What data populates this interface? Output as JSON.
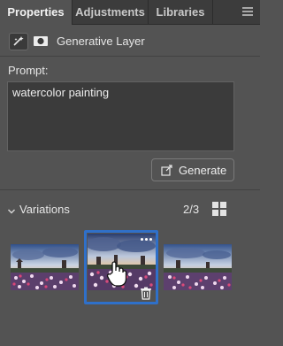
{
  "tabs": [
    {
      "label": "Properties",
      "active": true
    },
    {
      "label": "Adjustments",
      "active": false
    },
    {
      "label": "Libraries",
      "active": false
    }
  ],
  "panel_menu_icon": "hamburger-menu-icon",
  "layer": {
    "type_icon": "generative-layer-icon",
    "mask_icon": "layer-mask-icon",
    "name": "Generative Layer"
  },
  "prompt": {
    "label": "Prompt:",
    "value": "watercolor painting"
  },
  "generate_button": {
    "label": "Generate",
    "icon": "generate-icon"
  },
  "variations": {
    "label": "Variations",
    "count": "2/3",
    "selected_index": 2,
    "view_icon": "grid-view-icon",
    "items": [
      {
        "id": 1
      },
      {
        "id": 2,
        "selected": true
      },
      {
        "id": 3
      }
    ]
  },
  "colors": {
    "panel_bg": "#535353",
    "tab_bar_bg": "#3c3c3c",
    "input_bg": "#3b3b3b",
    "selection_accent": "#2f70c9",
    "text": "#e6e6e6"
  }
}
